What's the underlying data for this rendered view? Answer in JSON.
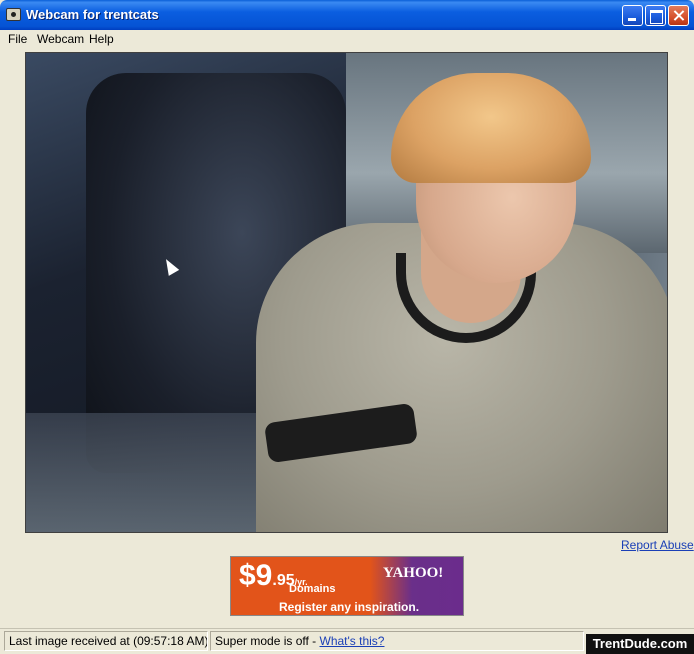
{
  "window": {
    "title": "Webcam for trentcats",
    "icon": "webcam-app-icon",
    "controls": {
      "minimize": "minimize-icon",
      "maximize": "maximize-icon",
      "close": "close-icon"
    }
  },
  "menu": {
    "items": [
      {
        "label": "File"
      },
      {
        "label": "Webcam"
      },
      {
        "label": "Help"
      }
    ]
  },
  "main": {
    "report_link": "Report Abuse"
  },
  "ad": {
    "price_main": "$9",
    "price_cents": ".95",
    "price_unit": "/yr.",
    "product": "Domains",
    "tagline": "Register any inspiration.",
    "brand": "YAHOO!"
  },
  "status": {
    "last_image": "Last image received at (09:57:18 AM)",
    "super_mode": "Super mode is off - ",
    "whats_this": "What's this?"
  },
  "watermark": "TrentDude.com"
}
